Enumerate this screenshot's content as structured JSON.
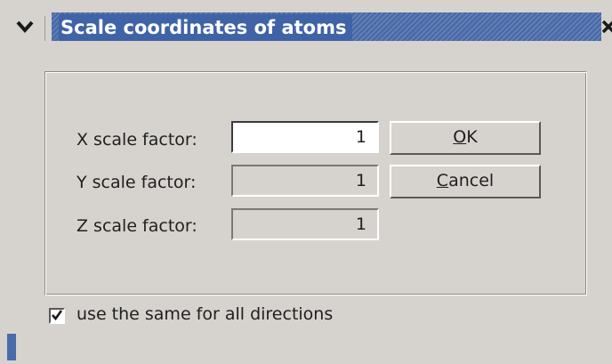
{
  "window": {
    "title": "Scale coordinates of atoms",
    "colors": {
      "titlebar": "#4a6aa8",
      "background": "#d6d3ce"
    }
  },
  "icons": {
    "menu": "chevron-down-icon",
    "close": "close-icon",
    "check": "checkmark-icon"
  },
  "fields": {
    "x": {
      "label": "X scale factor:",
      "value": "1"
    },
    "y": {
      "label": "Y scale factor:",
      "value": "1"
    },
    "z": {
      "label": "Z scale factor:",
      "value": "1"
    }
  },
  "buttons": {
    "ok": {
      "mnemonic": "O",
      "rest": "K"
    },
    "cancel": {
      "mnemonic": "C",
      "rest": "ancel"
    }
  },
  "same_for_all": {
    "label": "use the same for all directions",
    "checked": true
  }
}
